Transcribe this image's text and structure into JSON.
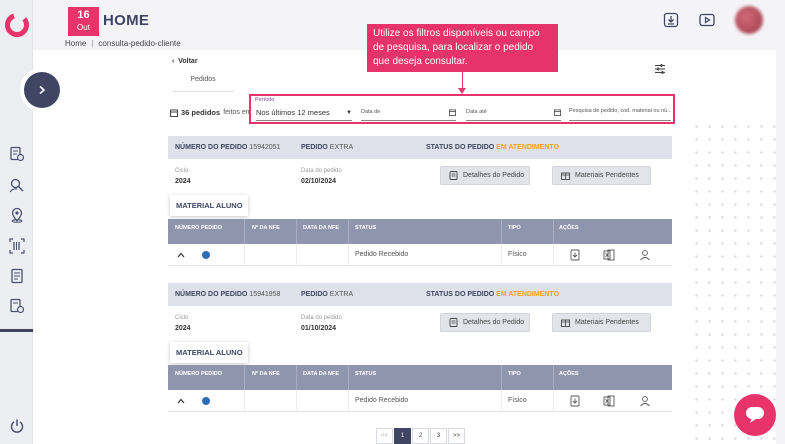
{
  "header": {
    "date_day": "16",
    "date_month": "Out",
    "title": "HOME",
    "breadcrumb": [
      "Home",
      "consulta-pedido-cliente"
    ],
    "breadcrumb_sep": "|"
  },
  "nav": {
    "back_label": "Voltar",
    "tab_label": "Pedidos"
  },
  "callout": {
    "text": "Utilize os filtros disponíveis ou campo de pesquisa, para localizar o pedido que deseja consultar."
  },
  "summary": {
    "count": "36 pedidos",
    "suffix": "feitos em"
  },
  "filters": {
    "period_label": "Período",
    "period_value": "Nos últimos 12 meses",
    "date_from_placeholder": "Data de",
    "date_to_placeholder": "Data até",
    "search_placeholder": "Pesquisa de pedido, cod. material ou nú..."
  },
  "orders": [
    {
      "number_label": "NÚMERO DO PEDIDO",
      "number": "15942051",
      "type_label": "PEDIDO",
      "type": "EXTRA",
      "status_label": "STATUS DO PEDIDO",
      "status": "EM ATENDIMENTO",
      "cycle_label": "Ciclo",
      "cycle": "2024",
      "date_label": "Data do pedido",
      "date": "02/10/2024",
      "details_btn": "Detalhes do Pedido",
      "pending_btn": "Materiais Pendentes",
      "material_tab": "MATERIAL ALUNO",
      "columns": [
        "NÚMERO PEDIDO",
        "Nº DA NFE",
        "DATA DA NFE",
        "STATUS",
        "TIPO",
        "AÇÕES"
      ],
      "row": {
        "status": "Pedido Recebido",
        "type": "Físico"
      }
    },
    {
      "number_label": "NÚMERO DO PEDIDO",
      "number": "15941958",
      "type_label": "PEDIDO",
      "type": "EXTRA",
      "status_label": "STATUS DO PEDIDO",
      "status": "EM ATENDIMENTO",
      "cycle_label": "Ciclo",
      "cycle": "2024",
      "date_label": "Data do pedido",
      "date": "01/10/2024",
      "details_btn": "Detalhes do Pedido",
      "pending_btn": "Materiais Pendentes",
      "material_tab": "MATERIAL ALUNO",
      "columns": [
        "NÚMERO PEDIDO",
        "Nº DA NFE",
        "DATA DA NFE",
        "STATUS",
        "TIPO",
        "AÇÕES"
      ],
      "row": {
        "status": "Pedido Recebido",
        "type": "Físico"
      }
    }
  ],
  "pagination": {
    "prev": "<<",
    "pages": [
      "1",
      "2",
      "3"
    ],
    "next": ">>",
    "current": "1"
  },
  "colors": {
    "brand_pink": "#e8336b",
    "navy": "#3f4563",
    "status_orange": "#f4a21b",
    "table_header": "#9095ae"
  },
  "icons": {
    "sidebar": [
      "orders-icon",
      "search-user-icon",
      "location-icon",
      "barcode-icon",
      "list-icon",
      "report-icon",
      "power-icon"
    ],
    "header": [
      "download-icon",
      "video-icon"
    ]
  }
}
